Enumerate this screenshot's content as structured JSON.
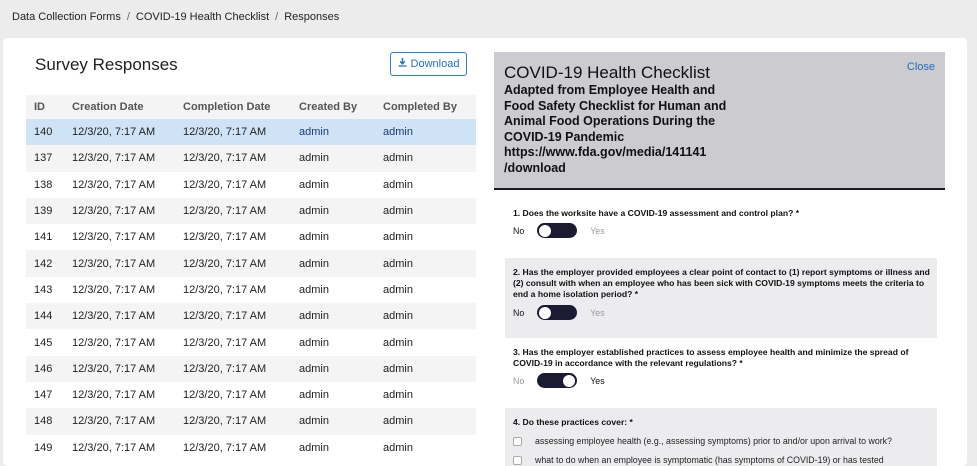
{
  "breadcrumb": [
    "Data Collection Forms",
    "COVID-19 Health Checklist",
    "Responses"
  ],
  "left": {
    "title": "Survey Responses",
    "download_label": "Download",
    "columns": [
      "ID",
      "Creation Date",
      "Completion Date",
      "Created By",
      "Completed By"
    ],
    "rows": [
      [
        "140",
        "12/3/20, 7:17 AM",
        "12/3/20, 7:17 AM",
        "admin",
        "admin"
      ],
      [
        "137",
        "12/3/20, 7:17 AM",
        "12/3/20, 7:17 AM",
        "admin",
        "admin"
      ],
      [
        "138",
        "12/3/20, 7:17 AM",
        "12/3/20, 7:17 AM",
        "admin",
        "admin"
      ],
      [
        "139",
        "12/3/20, 7:17 AM",
        "12/3/20, 7:17 AM",
        "admin",
        "admin"
      ],
      [
        "141",
        "12/3/20, 7:17 AM",
        "12/3/20, 7:17 AM",
        "admin",
        "admin"
      ],
      [
        "142",
        "12/3/20, 7:17 AM",
        "12/3/20, 7:17 AM",
        "admin",
        "admin"
      ],
      [
        "143",
        "12/3/20, 7:17 AM",
        "12/3/20, 7:17 AM",
        "admin",
        "admin"
      ],
      [
        "144",
        "12/3/20, 7:17 AM",
        "12/3/20, 7:17 AM",
        "admin",
        "admin"
      ],
      [
        "145",
        "12/3/20, 7:17 AM",
        "12/3/20, 7:17 AM",
        "admin",
        "admin"
      ],
      [
        "146",
        "12/3/20, 7:17 AM",
        "12/3/20, 7:17 AM",
        "admin",
        "admin"
      ],
      [
        "147",
        "12/3/20, 7:17 AM",
        "12/3/20, 7:17 AM",
        "admin",
        "admin"
      ],
      [
        "148",
        "12/3/20, 7:17 AM",
        "12/3/20, 7:17 AM",
        "admin",
        "admin"
      ],
      [
        "149",
        "12/3/20, 7:17 AM",
        "12/3/20, 7:17 AM",
        "admin",
        "admin"
      ]
    ],
    "selected_id": "140"
  },
  "detail": {
    "title": "COVID-19 Health Checklist",
    "subtitle": "Adapted from Employee Health and Food Safety Checklist for Human and Animal Food Operations During the COVID-19 Pandemic https://www.fda.gov/media/141141 /download",
    "close_label": "Close",
    "questions": [
      {
        "text": "1. Does the worksite have a COVID-19 assessment and control plan? *",
        "no": "No",
        "yes": "Yes",
        "value": "No"
      },
      {
        "text": "2. Has the employer provided employees a clear point of contact to (1) report symptoms or illness and (2) consult with when an employee who has been sick with COVID-19 symptoms meets the criteria to end a home isolation period? *",
        "no": "No",
        "yes": "Yes",
        "value": "No"
      },
      {
        "text": "3. Has the employer established practices to assess employee health and minimize the spread of COVID-19 in accordance with the relevant regulations? *",
        "no": "No",
        "yes": "Yes",
        "value": "Yes"
      }
    ],
    "q4": {
      "text": "4. Do these practices cover: *",
      "options": [
        "assessing employee health (e.g., assessing symptoms) prior to and/or upon arrival to work?",
        "what to do when an employee is symptomatic (has symptoms of COVID-19) or has tested"
      ]
    }
  },
  "colors": {
    "accent": "#1f6fc4",
    "selected_row": "#cfe3f7",
    "toggle": "#1b1b33",
    "header_panel": "#cbcbd0"
  }
}
